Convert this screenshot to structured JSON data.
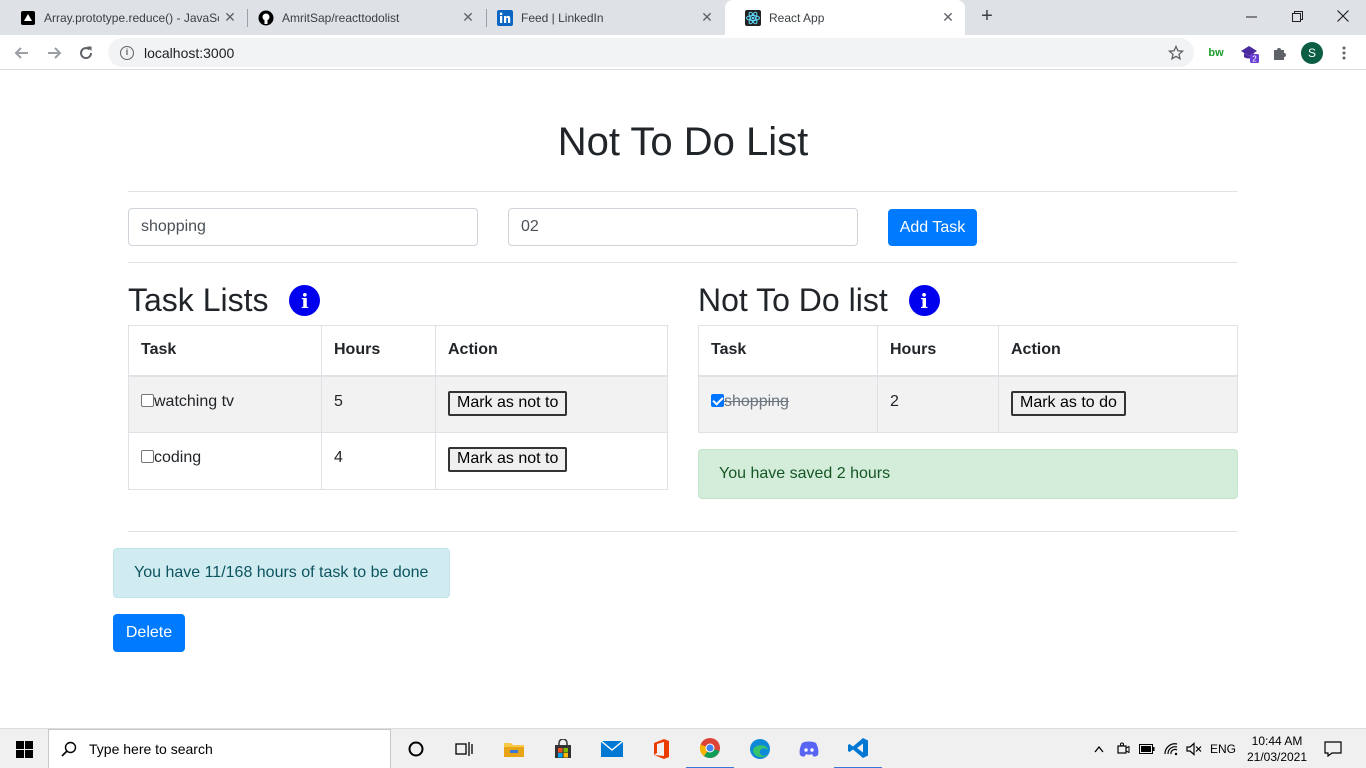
{
  "browser": {
    "tabs": [
      {
        "title": "Array.prototype.reduce() - JavaSc",
        "icon": "mdn-icon",
        "active": false
      },
      {
        "title": "AmritSap/reacttodolist",
        "icon": "github-icon",
        "active": false
      },
      {
        "title": "Feed | LinkedIn",
        "icon": "linkedin-icon",
        "active": false
      },
      {
        "title": "React App",
        "icon": "react-icon",
        "active": true
      }
    ],
    "url": "localhost:3000",
    "profile_initial": "S",
    "extension_badge": "2",
    "bw_label": "bw"
  },
  "page": {
    "title": "Not To Do List",
    "task_input_value": "shopping",
    "hours_input_value": "02",
    "add_button": "Add Task",
    "task_list": {
      "heading": "Task Lists",
      "columns": [
        "Task",
        "Hours",
        "Action"
      ],
      "rows": [
        {
          "task": "watching tv",
          "hours": "5",
          "action": "Mark as not to",
          "checked": false
        },
        {
          "task": "coding",
          "hours": "4",
          "action": "Mark as not to",
          "checked": false
        }
      ]
    },
    "not_to_do_list": {
      "heading": "Not To Do list",
      "columns": [
        "Task",
        "Hours",
        "Action"
      ],
      "rows": [
        {
          "task": "shopping",
          "hours": "2",
          "action": "Mark as to do",
          "checked": true
        }
      ],
      "saved_message": "You have saved 2 hours"
    },
    "total_message": "You have 11/168 hours of task to be done",
    "delete_button": "Delete"
  },
  "taskbar": {
    "search_placeholder": "Type here to search",
    "language": "ENG",
    "time": "10:44 AM",
    "date": "21/03/2021"
  },
  "colors": {
    "primary": "#007bff",
    "info_icon": "#0000ee",
    "success_bg": "#d4edda",
    "info_bg": "#d1ecf1"
  }
}
